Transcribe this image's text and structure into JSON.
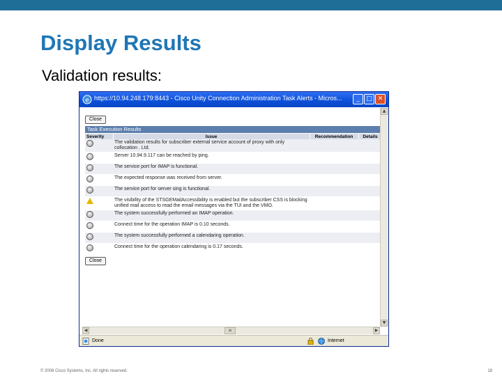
{
  "slide": {
    "title": "Display Results",
    "subtitle": "Validation results:",
    "copyright": "© 2006 Cisco Systems, Inc. All rights reserved.",
    "page_number": "18"
  },
  "window": {
    "title": "https://10.94.248.179:8443 - Cisco Unity Connection Administration Task Alerts - Micros...",
    "close_button_label": "Close",
    "panel_title": "Task Execution Results",
    "columns": [
      "Severity",
      "Issue",
      "Recommendation",
      "Details"
    ],
    "rows": [
      {
        "severity": "info",
        "issue": "The validation results for subscriber external service account of proxy with only collocation . Ltd."
      },
      {
        "severity": "info",
        "issue": "Server 10.94.9.117 can be reached by ping."
      },
      {
        "severity": "info",
        "issue": "The service port for IMAP is functional."
      },
      {
        "severity": "info",
        "issue": "The expected response was received from server."
      },
      {
        "severity": "info",
        "issue": "The service port for server sing is functional."
      },
      {
        "severity": "warning",
        "issue": "The visibility of the STSGEMailAccessibility is enabled but the subscriber CSS is blocking unified mail access to read the email messages via the TUI and the VMO."
      },
      {
        "severity": "info",
        "issue": "The system successfully performed an IMAP operation."
      },
      {
        "severity": "info",
        "issue": "Connect time for the operation IMAP is 0.10 seconds."
      },
      {
        "severity": "info",
        "issue": "The system successfully performed a calendaring operation."
      },
      {
        "severity": "info",
        "issue": "Connect time for the operation calendaring is 0.17 seconds."
      }
    ],
    "status_left": "Done",
    "status_right": "Internet",
    "colors": {
      "titlebar": "#0b4fd8",
      "panel_header": "#5d7fad",
      "slide_title": "#1f76b5",
      "topbar": "#1f6e98"
    }
  }
}
